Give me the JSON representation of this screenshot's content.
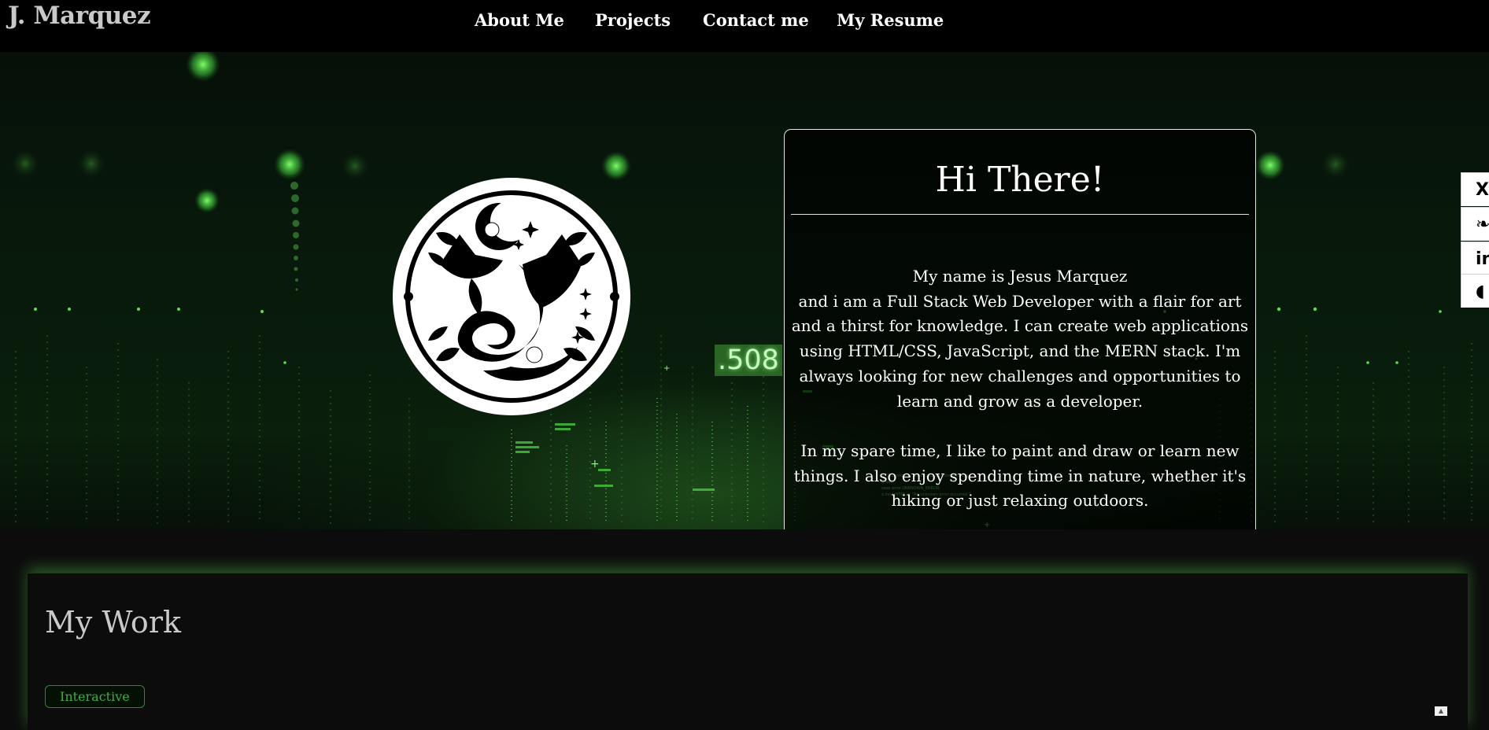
{
  "header": {
    "brand": "J. Marquez",
    "nav": [
      "About Me",
      "Projects",
      "Contact me",
      "My Resume"
    ]
  },
  "hero": {
    "floating_number": ".508",
    "card": {
      "title": "Hi There!",
      "paragraph1": [
        "My name is Jesus Marquez",
        "and i am a Full Stack Web Developer with a flair for art",
        "and a thirst for knowledge. I can create web applications",
        "using HTML/CSS, JavaScript, and the MERN stack. I'm",
        "always looking for new challenges and opportunities to",
        "learn and grow as a developer."
      ],
      "paragraph2": [
        "In my spare time, I like to paint and draw or learn new",
        "things. I also enjoy spending time in nature, whether it's",
        "hiking or just relaxing outdoors."
      ]
    }
  },
  "social": {
    "x": "X",
    "bluesky": "❧",
    "linkedin": "in",
    "github": "◖"
  },
  "work": {
    "title": "My Work",
    "tag": "Interactive"
  },
  "icons": {
    "social_x": "x-icon",
    "social_bluesky": "bluesky-icon",
    "social_linkedin": "linkedin-icon",
    "social_github": "github-icon",
    "scroll": "chevron-up-icon"
  },
  "colors": {
    "accent_green": "#3fae3f",
    "header_bg": "#000000"
  }
}
